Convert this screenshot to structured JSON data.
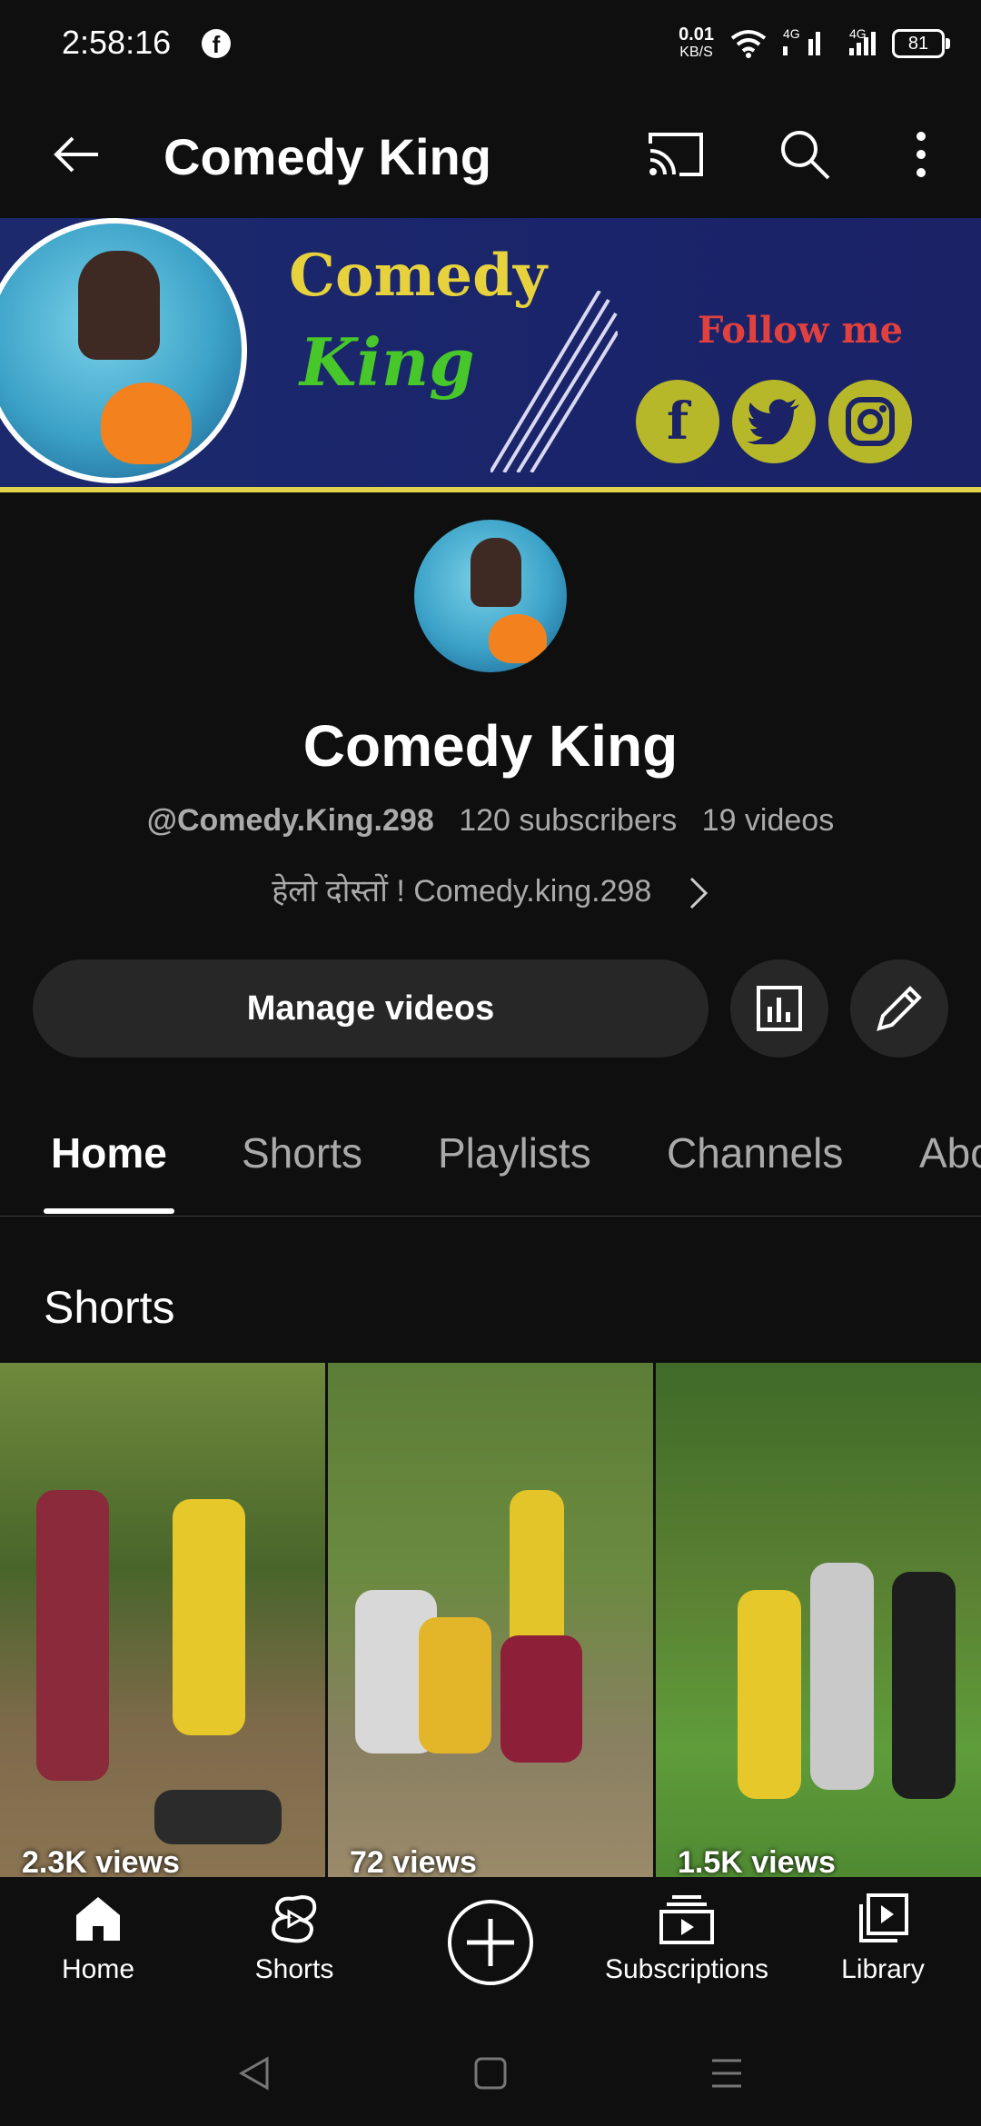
{
  "status_bar": {
    "time": "2:58:16",
    "speed_value": "0.01",
    "speed_unit": "KB/S",
    "network1": "4G",
    "network2": "4G",
    "battery": "81"
  },
  "app_bar": {
    "title": "Comedy King"
  },
  "banner": {
    "line1": "Comedy",
    "line2": "King",
    "follow": "Follow me"
  },
  "channel": {
    "name": "Comedy King",
    "handle": "@Comedy.King.298",
    "subscribers": "120 subscribers",
    "videos": "19 videos",
    "description": "हेलो दोस्तों ! Comedy.king.298"
  },
  "actions": {
    "manage_label": "Manage videos"
  },
  "tabs": [
    "Home",
    "Shorts",
    "Playlists",
    "Channels",
    "About"
  ],
  "shelf": {
    "title": "Shorts",
    "items": [
      {
        "views": "2.3K views"
      },
      {
        "views": "72 views"
      },
      {
        "views": "1.5K views"
      }
    ]
  },
  "bottom_nav": [
    {
      "label": "Home",
      "icon": "home-icon"
    },
    {
      "label": "Shorts",
      "icon": "shorts-icon"
    },
    {
      "label": "",
      "icon": "create-icon"
    },
    {
      "label": "Subscriptions",
      "icon": "subscriptions-icon"
    },
    {
      "label": "Library",
      "icon": "library-icon"
    }
  ],
  "colors": {
    "background": "#0f0f0f",
    "button_bg": "#272727",
    "secondary_text": "#aaaaaa"
  }
}
